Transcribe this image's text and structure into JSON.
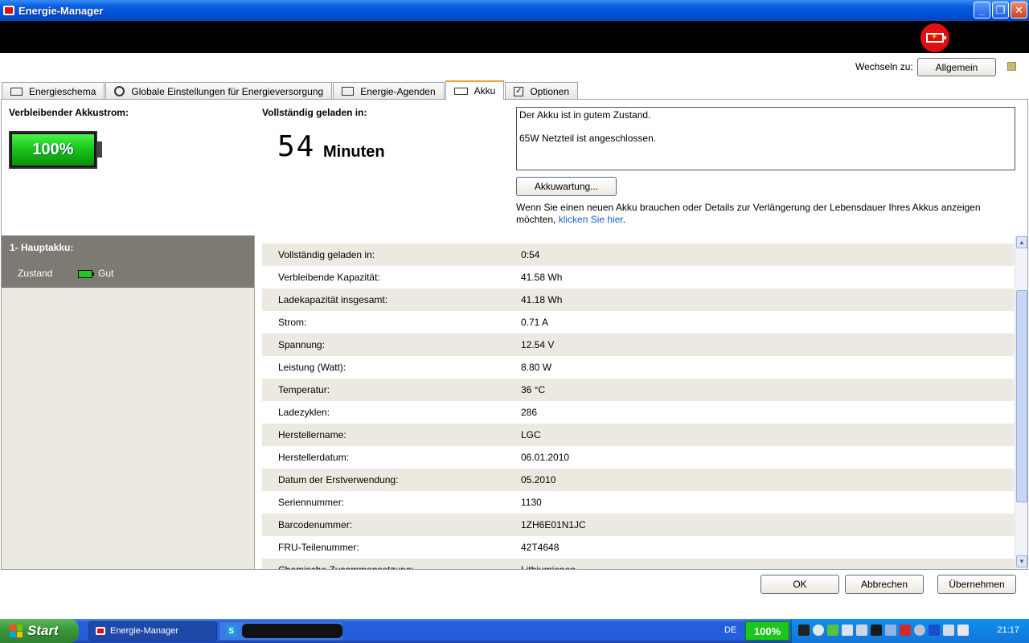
{
  "window": {
    "title": "Energie-Manager",
    "controls": [
      "_",
      "❐",
      "✕"
    ]
  },
  "header": {
    "switch_label": "Wechseln zu:",
    "switch_button": "Allgemein"
  },
  "tabs": [
    {
      "label": "Energieschema",
      "icon": "scheme-icon"
    },
    {
      "label": "Globale Einstellungen für Energieversorgung",
      "icon": "gear-icon"
    },
    {
      "label": "Energie-Agenden",
      "icon": "agenda-icon"
    },
    {
      "label": "Akku",
      "icon": "battery-icon",
      "active": true
    },
    {
      "label": "Optionen",
      "icon": "checkbox-icon"
    }
  ],
  "summary": {
    "remaining_label": "Verbleibender Akkustrom:",
    "remaining_percent": "100%",
    "remaining_level": 1.0,
    "full_label": "Vollständig geladen in:",
    "full_digits": "54",
    "full_unit": "Minuten",
    "status_lines": [
      "Der Akku ist in gutem Zustand.",
      "65W Netzteil ist angeschlossen."
    ],
    "maintenance_button": "Akkuwartung...",
    "description": "Wenn Sie einen neuen Akku brauchen oder Details zur Verlängerung der Lebensdauer Ihres Akkus anzeigen möchten,",
    "link_text": "klicken Sie hier",
    "link_suffix": "."
  },
  "battery_list": {
    "title": "1- Hauptakku:",
    "state_label": "Zustand",
    "state_value": "Gut"
  },
  "details": [
    {
      "key": "Vollständig geladen in:",
      "value": "0:54"
    },
    {
      "key": "Verbleibende Kapazität:",
      "value": "41.58 Wh"
    },
    {
      "key": "Ladekapazität insgesamt:",
      "value": "41.18 Wh"
    },
    {
      "key": "Strom:",
      "value": "0.71 A"
    },
    {
      "key": "Spannung:",
      "value": "12.54 V"
    },
    {
      "key": "Leistung (Watt):",
      "value": "8.80 W"
    },
    {
      "key": "Temperatur:",
      "value": "36 °C"
    },
    {
      "key": "Ladezyklen:",
      "value": "286"
    },
    {
      "key": "Herstellername:",
      "value": "LGC"
    },
    {
      "key": "Herstellerdatum:",
      "value": "06.01.2010"
    },
    {
      "key": "Datum der Erstverwendung:",
      "value": "05.2010"
    },
    {
      "key": "Seriennummer:",
      "value": "1130"
    },
    {
      "key": "Barcodenummer:",
      "value": "1ZH6E01N1JC"
    },
    {
      "key": "FRU-Teilenummer:",
      "value": "42T4648"
    },
    {
      "key": "Chemische Zusammensetzung:",
      "value": "Lithiumionen"
    }
  ],
  "footer": {
    "ok": "OK",
    "cancel": "Abbrechen",
    "apply": "Übernehmen"
  },
  "taskbar": {
    "start": "Start",
    "active_task": "Energie-Manager",
    "language": "DE",
    "battery_percent": "100%",
    "clock": "21:17"
  }
}
